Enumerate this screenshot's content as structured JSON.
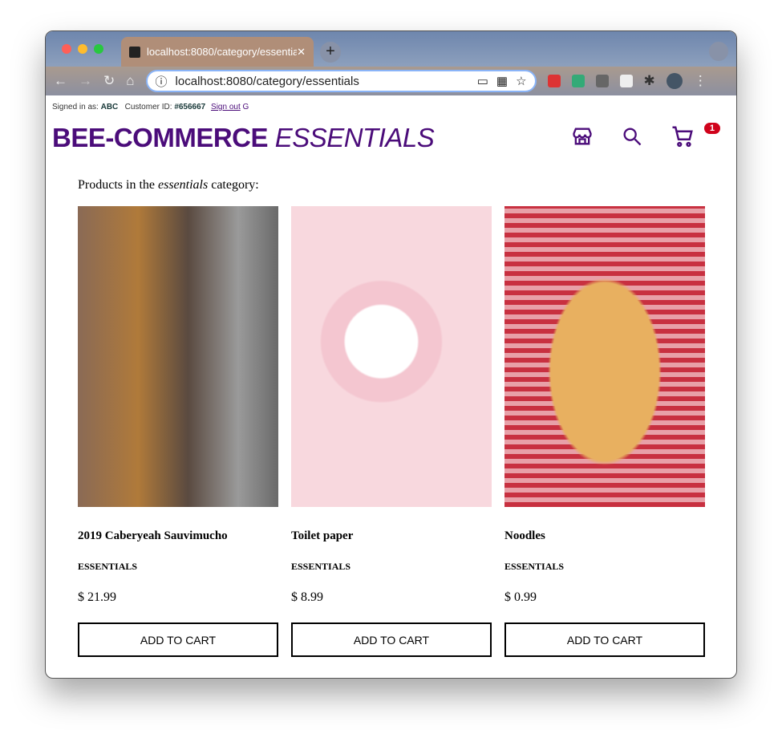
{
  "browser": {
    "tab_title": "localhost:8080/category/essentials",
    "url": "localhost:8080/category/essentials"
  },
  "user": {
    "signed_label": "Signed in as:",
    "name": "ABC",
    "customer_label": "Customer ID:",
    "customer_id": "#656667",
    "sign_out": "Sign out"
  },
  "brand": {
    "main": "BEE-COMMERCE",
    "sub": "ESSENTIALS"
  },
  "cart": {
    "count": "1"
  },
  "intro": {
    "prefix": "Products in the ",
    "category": "essentials",
    "suffix": " category:"
  },
  "products": [
    {
      "name": "2019 Caberyeah Sauvimucho",
      "category": "ESSENTIALS",
      "price": "$ 21.99",
      "button": "ADD TO CART"
    },
    {
      "name": "Toilet paper",
      "category": "ESSENTIALS",
      "price": "$ 8.99",
      "button": "ADD TO CART"
    },
    {
      "name": "Noodles",
      "category": "ESSENTIALS",
      "price": "$ 0.99",
      "button": "ADD TO CART"
    }
  ],
  "colors": {
    "brand": "#4b0c7a",
    "badge": "#d0021b"
  }
}
